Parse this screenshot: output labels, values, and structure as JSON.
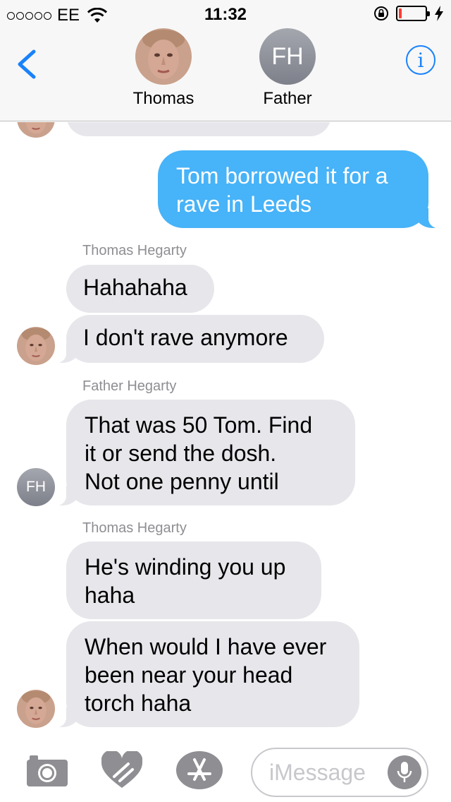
{
  "status_bar": {
    "carrier": "EE",
    "time": "11:32",
    "battery_level": 0.12,
    "battery_color": "#ff3b30"
  },
  "header": {
    "back_icon": "chevron-left-icon",
    "participants": [
      {
        "name": "Thomas",
        "avatar": "photo"
      },
      {
        "name": "Father",
        "avatar_initials": "FH"
      }
    ],
    "info_icon": "info-icon",
    "info_glyph": "i"
  },
  "messages": {
    "m1": {
      "text_line1": "Tom borrowed it for a",
      "text_line2": "rave in Leeds"
    },
    "sender1": "Thomas Hegarty",
    "m2": {
      "text": "Hahahaha"
    },
    "m3": {
      "text": "I don't rave anymore"
    },
    "sender2": "Father Hegarty",
    "m4": {
      "text_line1": "That was 50 Tom.  Find",
      "text_line2": "it or send the dosh.",
      "text_line3": "Not one penny until"
    },
    "father_initials": "FH",
    "sender3": "Thomas Hegarty",
    "m5": {
      "text_line1": "He's winding you up",
      "text_line2": "haha"
    },
    "m6": {
      "text_line1": "When would I have ever",
      "text_line2": "been near your head",
      "text_line3": "torch haha"
    }
  },
  "input_bar": {
    "placeholder": "iMessage",
    "icons": [
      "camera-icon",
      "digital-touch-heart-icon",
      "app-store-icon",
      "microphone-icon"
    ]
  },
  "colors": {
    "accent": "#1a82fb",
    "outgoing_bubble": "#47b3f8",
    "incoming_bubble": "#e6e6eb",
    "meta_text": "#8e8e93"
  }
}
